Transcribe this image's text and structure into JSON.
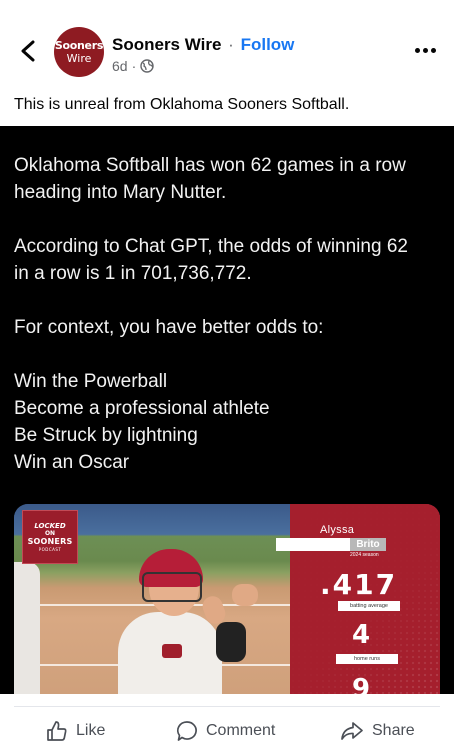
{
  "header": {
    "page_name": "Sooners Wire",
    "separator": "·",
    "follow_label": "Follow",
    "time_ago": "6d",
    "time_separator": "·",
    "avatar_line1": "Sooners",
    "avatar_line2": "Wire"
  },
  "caption": "This is unreal from Oklahoma Sooners Softball.",
  "post": {
    "lines1": [
      "Oklahoma Softball has won 62 games in a row",
      "heading into Mary Nutter."
    ],
    "lines2": [
      "According to Chat GPT, the odds of winning 62",
      "in a row is 1 in 701,736,772."
    ],
    "line3": "For context, you have better odds to:",
    "list": [
      "Win the Powerball",
      "Become a professional athlete",
      "Be Struck by lightning",
      "Win an Oscar"
    ]
  },
  "media": {
    "logo_line1": "LOCKED",
    "logo_line2": "ON",
    "logo_line3": "SOONERS",
    "logo_line4": "PODCAST",
    "first_name": "Alyssa",
    "last_name": "Brito",
    "season": "2024 season",
    "stat1_value": ".417",
    "stat1_label": "batting average",
    "stat2_value": "4",
    "stat2_label": "home runs",
    "stat3_value": "9"
  },
  "actions": {
    "like": "Like",
    "comment": "Comment",
    "share": "Share"
  },
  "colors": {
    "brand": "#8e1b22",
    "link": "#1877f2",
    "post_bg": "#000000"
  }
}
